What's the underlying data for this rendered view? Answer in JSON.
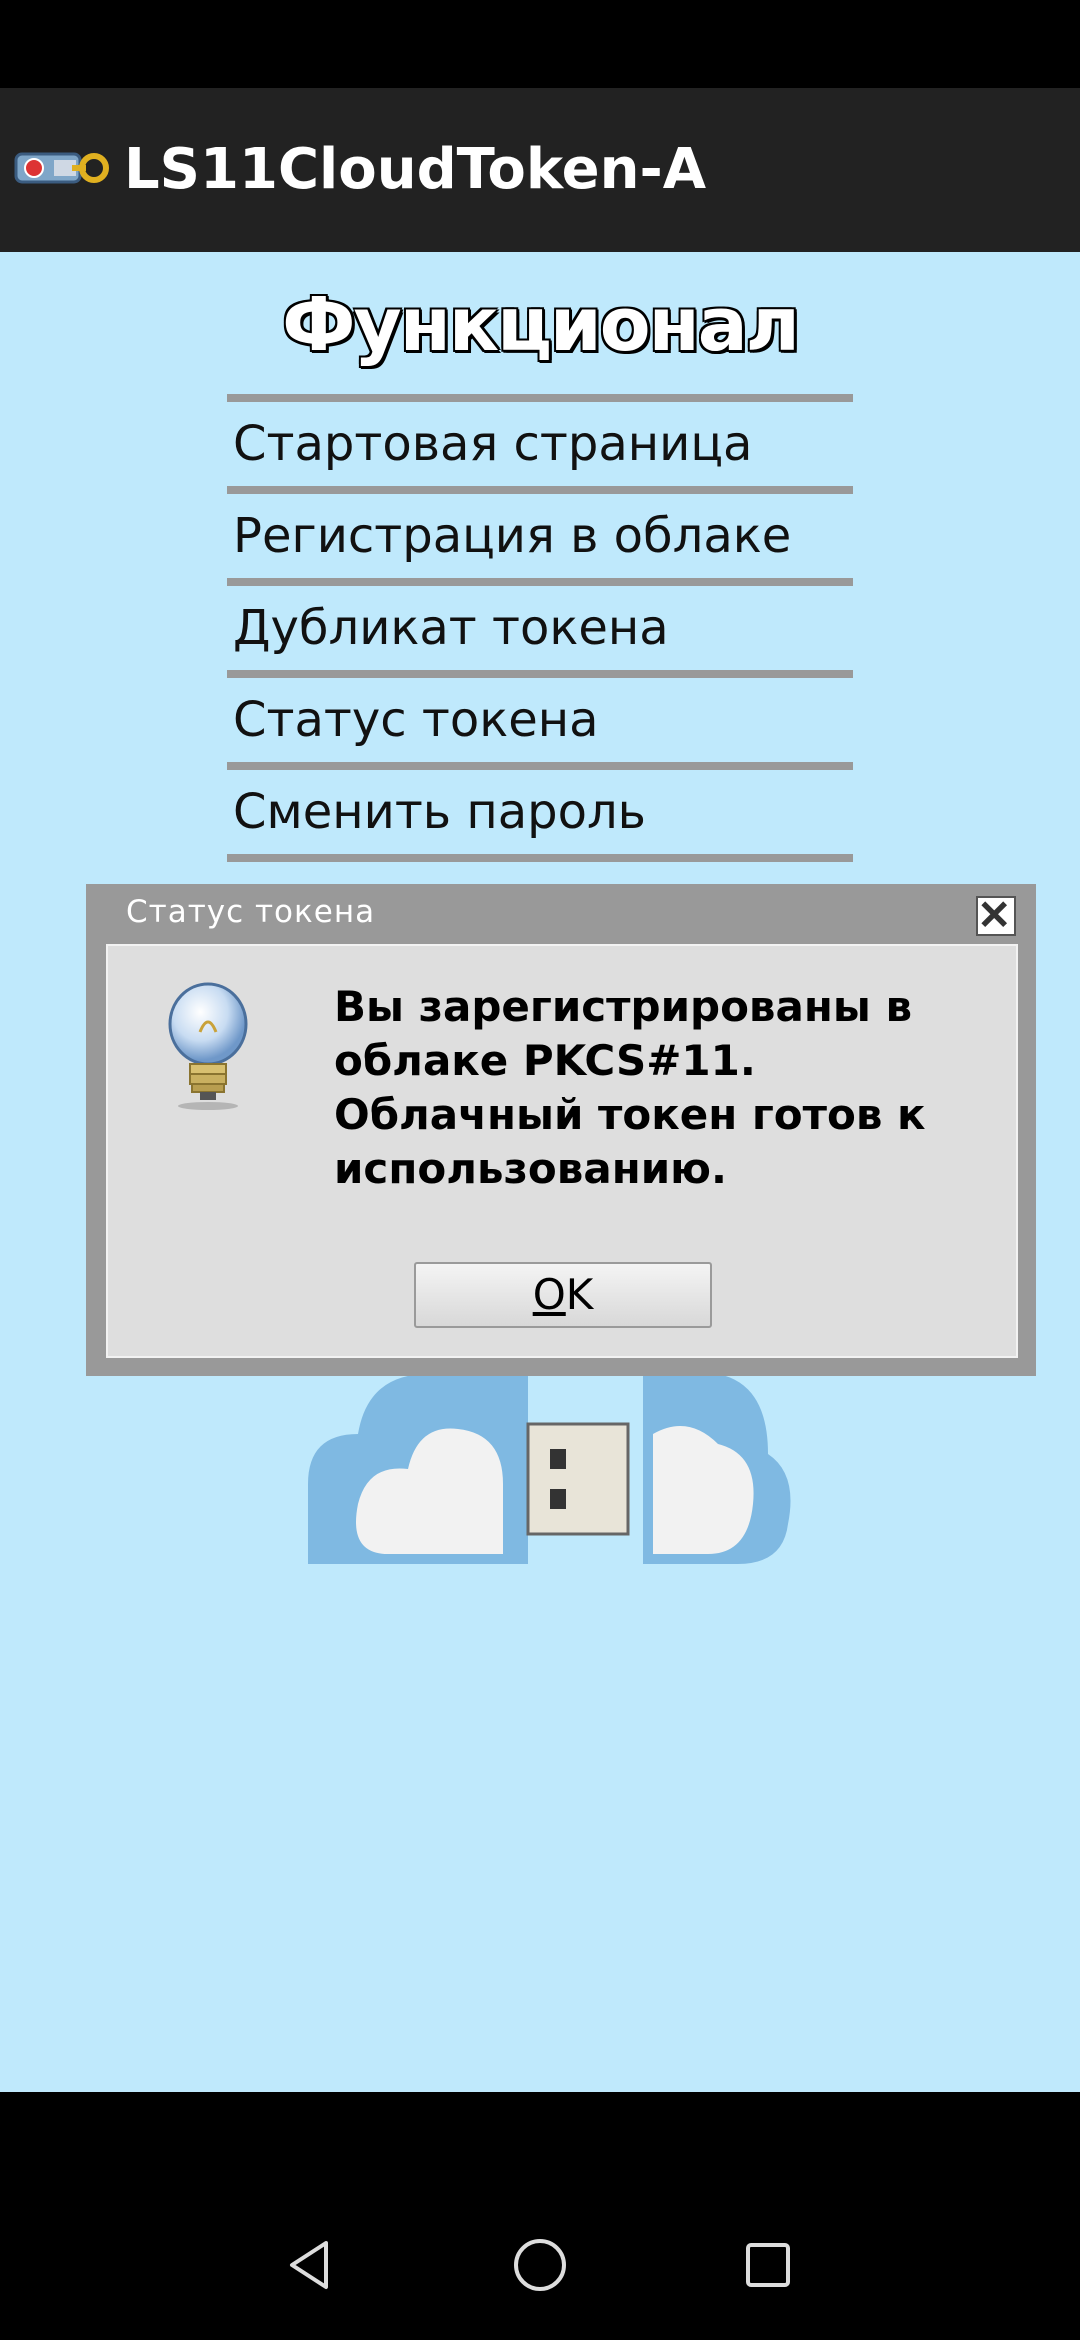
{
  "app": {
    "title": "LS11CloudToken-A"
  },
  "menu": {
    "heading": "Функционал",
    "items": [
      {
        "label": "Стартовая страница"
      },
      {
        "label": "Регистрация в облаке"
      },
      {
        "label": "Дубликат токена"
      },
      {
        "label": "Статус токена"
      },
      {
        "label": "Сменить пароль"
      }
    ]
  },
  "dialog": {
    "title": "Статус токена",
    "message": "Вы зарегистрированы в облаке PKCS#11. Облачный токен готов к использованию.",
    "ok_label_underlined": "O",
    "ok_label_rest": "K",
    "icon": "lightbulb-info-icon"
  },
  "icons": {
    "app": "token-key-icon",
    "close": "close-icon",
    "back": "nav-back-icon",
    "home": "nav-home-icon",
    "recents": "nav-recents-icon"
  },
  "colors": {
    "app_bar": "#222222",
    "content_bg": "#bfe9fc",
    "dialog_frame": "#999999",
    "dialog_body": "#dedede"
  }
}
